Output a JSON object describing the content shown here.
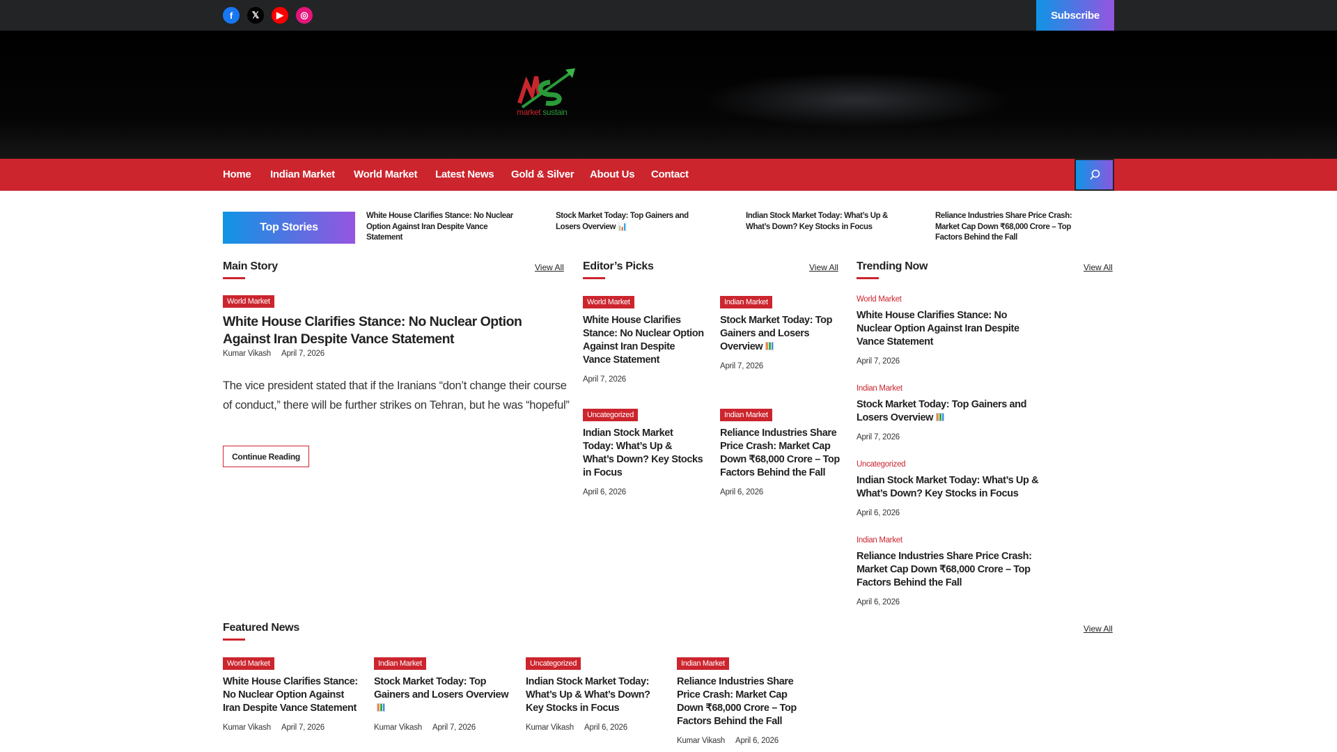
{
  "topbar": {
    "social": [
      {
        "name": "facebook",
        "glyph": "f",
        "color": "#1877f2"
      },
      {
        "name": "x",
        "glyph": "𝕏",
        "color": "#000000"
      },
      {
        "name": "youtube",
        "glyph": "▶",
        "color": "#ff0000"
      },
      {
        "name": "instagram",
        "glyph": "◎",
        "color": "#e4157a"
      }
    ],
    "subscribe": "Subscribe"
  },
  "logo": {
    "text1": "market",
    "text2": "sustain"
  },
  "nav": {
    "items": [
      "Home",
      "Indian Market",
      "World Market",
      "Latest News",
      "Gold & Silver",
      "About Us",
      "Contact"
    ]
  },
  "top_stories": {
    "label": "Top Stories",
    "items": [
      "White House Clarifies Stance: No Nuclear Option Against Iran Despite Vance Statement",
      "Stock Market Today: Top Gainers and Losers Overview 📊",
      "Indian Stock Market Today: What’s Up & What’s Down? Key Stocks in Focus",
      "Reliance Industries Share Price Crash: Market Cap Down ₹68,000 Crore – Top Factors Behind the Fall"
    ]
  },
  "main_story": {
    "heading": "Main Story",
    "view_all": "View All",
    "category": "World Market",
    "title": "White House Clarifies Stance: No Nuclear Option Against Iran Despite Vance Statement",
    "author": "Kumar Vikash",
    "date": "April 7, 2026",
    "excerpt": "The vice president stated that if the Iranians “don’t change their course of conduct,” there will be further strikes on Tehran, but he was “hopeful”",
    "button": "Continue Reading"
  },
  "editors_picks": {
    "heading": "Editor’s Picks",
    "view_all": "View All",
    "items": [
      {
        "category": "World Market",
        "title": "White House Clarifies Stance: No Nuclear Option Against Iran Despite Vance Statement",
        "date": "April 7, 2026"
      },
      {
        "category": "Indian Market",
        "title": "Stock Market Today: Top Gainers and Losers Overview",
        "emoji": true,
        "date": "April 7, 2026"
      },
      {
        "category": "Uncategorized",
        "title": "Indian Stock Market Today: What’s Up & What’s Down? Key Stocks in Focus",
        "date": "April 6, 2026"
      },
      {
        "category": "Indian Market",
        "title": "Reliance Industries Share Price Crash: Market Cap Down ₹68,000 Crore – Top Factors Behind the Fall",
        "date": "April 6, 2026"
      }
    ]
  },
  "trending": {
    "heading": "Trending Now",
    "view_all": "View All",
    "items": [
      {
        "category": "World Market",
        "title": "White House Clarifies Stance: No Nuclear Option Against Iran Despite Vance Statement",
        "date": "April 7, 2026"
      },
      {
        "category": "Indian Market",
        "title": "Stock Market Today: Top Gainers and Losers Overview",
        "emoji": true,
        "date": "April 7, 2026"
      },
      {
        "category": "Uncategorized",
        "title": "Indian Stock Market Today: What’s Up & What’s Down? Key Stocks in Focus",
        "date": "April 6, 2026"
      },
      {
        "category": "Indian Market",
        "title": "Reliance Industries Share Price Crash: Market Cap Down ₹68,000 Crore – Top Factors Behind the Fall",
        "date": "April 6, 2026"
      }
    ]
  },
  "featured": {
    "heading": "Featured News",
    "view_all": "View All",
    "items": [
      {
        "category": "World Market",
        "title": "White House Clarifies Stance: No Nuclear Option Against Iran Despite Vance Statement",
        "author": "Kumar Vikash",
        "date": "April 7, 2026"
      },
      {
        "category": "Indian Market",
        "title": "Stock Market Today: Top Gainers and Losers Overview",
        "emoji": true,
        "author": "Kumar Vikash",
        "date": "April 7, 2026"
      },
      {
        "category": "Uncategorized",
        "title": "Indian Stock Market Today: What’s Up & What’s Down? Key Stocks in Focus",
        "author": "Kumar Vikash",
        "date": "April 6, 2026"
      },
      {
        "category": "Indian Market",
        "title": "Reliance Industries Share Price Crash: Market Cap Down ₹68,000 Crore – Top Factors Behind the Fall",
        "author": "Kumar Vikash",
        "date": "April 6, 2026"
      }
    ]
  }
}
